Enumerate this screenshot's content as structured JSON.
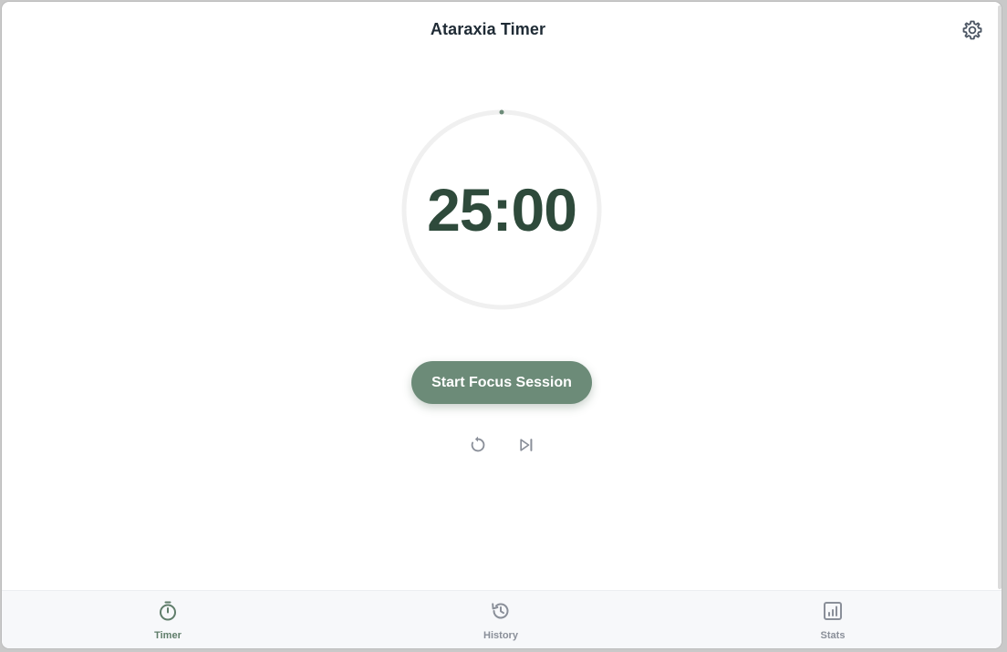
{
  "app": {
    "title": "Ataraxia Timer"
  },
  "header": {
    "settings_icon": "gear-icon"
  },
  "timer": {
    "display": "25:00",
    "progress": 0
  },
  "controls": {
    "start_label": "Start Focus Session",
    "reset_icon": "reset-icon",
    "skip_icon": "skip-next-icon"
  },
  "nav": {
    "items": [
      {
        "label": "Timer",
        "icon": "stopwatch-icon",
        "active": true
      },
      {
        "label": "History",
        "icon": "history-icon",
        "active": false
      },
      {
        "label": "Stats",
        "icon": "bar-chart-icon",
        "active": false
      }
    ]
  },
  "colors": {
    "accent": "#6c8b78",
    "timer_text": "#2e4a3b",
    "title_text": "#1f2b35",
    "ring": "#f0f0f0",
    "active_nav": "#5f7d6a",
    "inactive_nav": "#8a8f99"
  }
}
